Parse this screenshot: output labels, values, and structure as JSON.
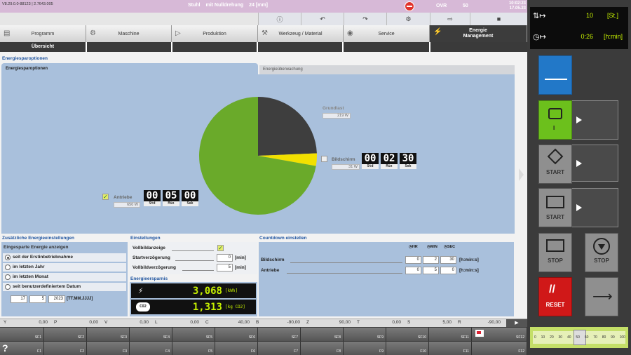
{
  "header": {
    "version": "V8.29.0.0-88123 | 2.7643.005",
    "program": "Stuhl",
    "mode": "mit Nulldrehung",
    "size": "24 [mm]",
    "ovr_label": "OVR",
    "ovr_value": "50",
    "time": "10:02:23",
    "date": "17.05.23"
  },
  "main_tabs": [
    "Programm",
    "Maschine",
    "Produktion",
    "Werkzeug / Material",
    "Service",
    "Energie Management"
  ],
  "sub_tab": "Übersicht",
  "section_title": "Energiesparoptionen",
  "panel_tabs": [
    "Energiesparoptionen",
    "Energieüberwachung"
  ],
  "pie": {
    "grundlast": {
      "label": "Grundlast",
      "value": "219 W",
      "watts": 219,
      "color": "#3e3e3e"
    },
    "bildschirm": {
      "label": "Bildschirm",
      "value": "31 W",
      "watts": 31,
      "color": "#f2e000"
    },
    "antriebe": {
      "label": "Antriebe",
      "value": "650 W",
      "watts": 650,
      "color": "#6aaa2a"
    }
  },
  "timers": {
    "bildschirm": {
      "h": "00",
      "m": "02",
      "s": "30"
    },
    "antriebe": {
      "h": "00",
      "m": "05",
      "s": "00"
    },
    "units": [
      "Std",
      "Min",
      "Sek"
    ]
  },
  "zusatz": {
    "title": "Zusätzliche Energieeinstellungen",
    "subtitle": "Eingesparte Energie anzeigen",
    "options": [
      "seit der Erstinbetriebnahme",
      "im letzten Jahr",
      "im letzten Monat",
      "seit benutzerdefiniertem Datum"
    ],
    "date_day": "17",
    "date_month": "5",
    "date_year": "2023",
    "date_format": "[TT.MM.JJJJ]"
  },
  "einstellungen": {
    "title": "Einstellungen",
    "vollbild_label": "Vollbildanzeige",
    "start_label": "Startverzögerung",
    "start_value": "0",
    "vollbild_delay_label": "Vollbildverzögerung",
    "vollbild_delay_value": "5",
    "unit": "[min]"
  },
  "energieersparnis": {
    "title": "Energieersparnis",
    "kwh": "3,068",
    "kwh_unit": "[kWh]",
    "co2": "1,313",
    "co2_unit": "[kg CO2]",
    "co2_icon_text": "CO2"
  },
  "countdown": {
    "title": "Countdown einstellen",
    "headers": [
      "HR",
      "MIN",
      "SEC"
    ],
    "rows": [
      {
        "label": "Bildschirm",
        "h": "0",
        "m": "2",
        "s": "30",
        "unit": "[h:min:s]"
      },
      {
        "label": "Antriebe",
        "h": "0",
        "m": "5",
        "s": "0",
        "unit": "[h:min:s]"
      }
    ]
  },
  "axes": [
    {
      "name": "Y",
      "value": "0,00"
    },
    {
      "name": "P",
      "value": "0,00"
    },
    {
      "name": "V",
      "value": "0,00"
    },
    {
      "name": "L",
      "value": "0,00"
    },
    {
      "name": "C",
      "value": "40,00"
    },
    {
      "name": "B",
      "value": "-90,00"
    },
    {
      "name": "Z",
      "value": "90,00"
    },
    {
      "name": "T",
      "value": "0,00"
    },
    {
      "name": "S",
      "value": "5,00"
    },
    {
      "name": "R",
      "value": "-90,00"
    }
  ],
  "softkeys_top": [
    "SF1",
    "SF2",
    "SF3",
    "SF4",
    "SF5",
    "SF6",
    "SF7",
    "SF8",
    "SF9",
    "SF10",
    "SF11",
    "SF12"
  ],
  "softkeys_bottom": [
    "F1",
    "F2",
    "F3",
    "F4",
    "F5",
    "F6",
    "F7",
    "F8",
    "F9",
    "F10",
    "F11",
    "F12"
  ],
  "help_label": "?",
  "right_panel": {
    "count_value": "10",
    "count_unit": "[St.]",
    "time_value": "0:26",
    "time_unit": "[h:min]",
    "start1": "START",
    "start2": "START",
    "stop1": "STOP",
    "stop2": "STOP",
    "reset": "RESET",
    "slider_ticks": [
      "0",
      "10",
      "20",
      "30",
      "40",
      "50",
      "60",
      "70",
      "80",
      "90",
      "100"
    ]
  }
}
